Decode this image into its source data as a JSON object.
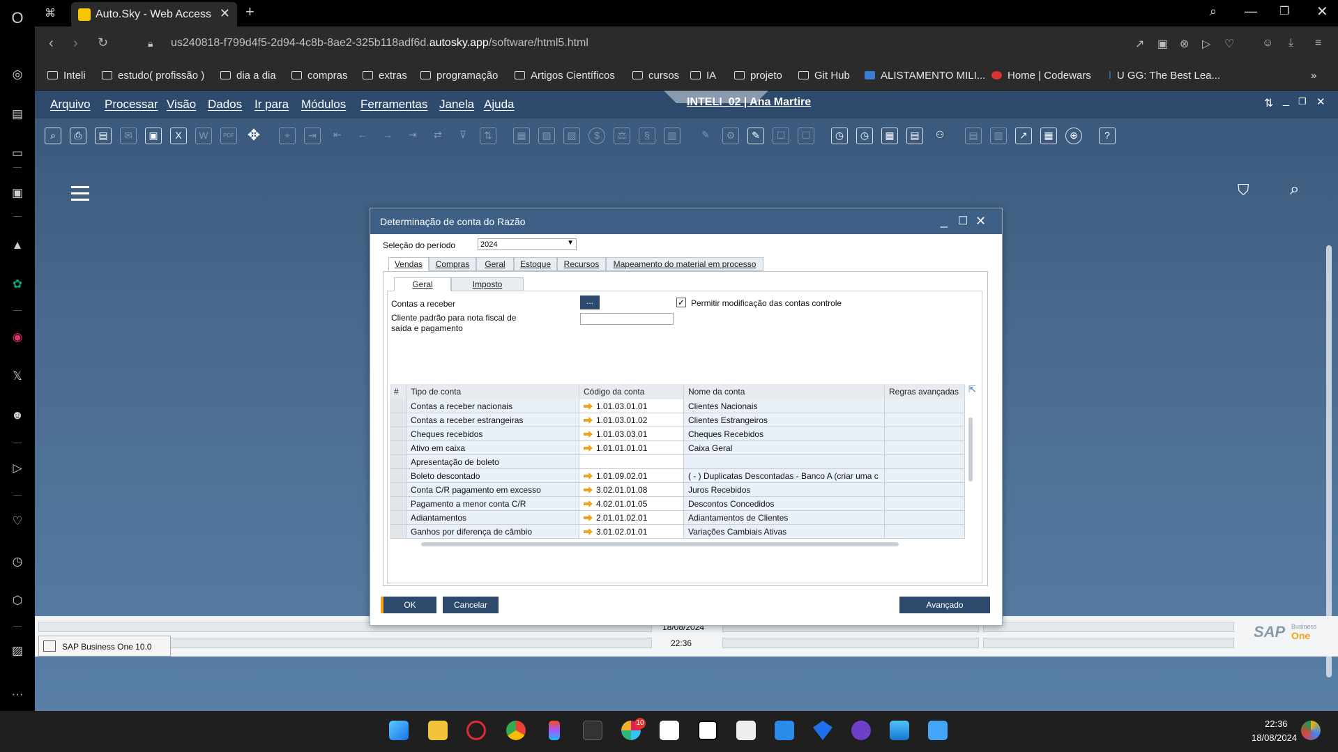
{
  "browser": {
    "tab_title": "Auto.Sky - Web Access",
    "url_prefix": "us240818-f799d4f5-2d94-4c8b-8ae2-325b118adf6d.",
    "url_domain": "autosky.app",
    "url_suffix": "/software/html5.html",
    "bookmarks": [
      "Inteli",
      "estudo( profissão )",
      "dia a dia",
      "compras",
      "extras",
      "programação",
      "Artigos Científicos",
      "cursos",
      "IA",
      "projeto",
      "Git Hub",
      "ALISTAMENTO MILI...",
      "Home | Codewars",
      "GG: The Best Lea..."
    ]
  },
  "sap": {
    "menus": [
      "Arquivo",
      "Processar",
      "Visão",
      "Dados",
      "Ir para",
      "Módulos",
      "Ferramentas",
      "Janela",
      "Ajuda"
    ],
    "db_title": "INTELI_02 | Ana Martire"
  },
  "dialog": {
    "title": "Determinação de conta do Razão",
    "period_label": "Seleção do período",
    "period_value": "2024",
    "tabs": [
      "Vendas",
      "Compras",
      "Geral",
      "Estoque",
      "Recursos",
      "Mapeamento do material em processo"
    ],
    "subtabs": [
      "Geral",
      "Imposto"
    ],
    "contas_receber_label": "Contas a receber",
    "ellipsis_button": "...",
    "cliente_padrao_label": "Cliente padrão para nota fiscal de saída e pagamento",
    "permitir_label": "Permitir modificação das contas controle",
    "permitir_checked": true,
    "table_headers": [
      "#",
      "Tipo de conta",
      "Código da conta",
      "Nome da conta",
      "Regras avançadas"
    ],
    "rows": [
      {
        "tipo": "Contas a receber nacionais",
        "codigo": "1.01.03.01.01",
        "nome": "Clientes Nacionais"
      },
      {
        "tipo": "Contas a receber estrangeiras",
        "codigo": "1.01.03.01.02",
        "nome": "Clientes Estrangeiros"
      },
      {
        "tipo": "Cheques recebidos",
        "codigo": "1.01.03.03.01",
        "nome": "Cheques Recebidos"
      },
      {
        "tipo": "Ativo em caixa",
        "codigo": "1.01.01.01.01",
        "nome": "Caixa Geral"
      },
      {
        "tipo": "Apresentação de boleto",
        "codigo": "",
        "nome": ""
      },
      {
        "tipo": "Boleto descontado",
        "codigo": "1.01.09.02.01",
        "nome": "( - ) Duplicatas Descontadas - Banco A (criar uma c"
      },
      {
        "tipo": "Conta C/R pagamento em excesso",
        "codigo": "3.02.01.01.08",
        "nome": "Juros Recebidos"
      },
      {
        "tipo": "Pagamento a menor conta C/R",
        "codigo": "4.02.01.01.05",
        "nome": "Descontos Concedidos"
      },
      {
        "tipo": "Adiantamentos",
        "codigo": "2.01.01.02.01",
        "nome": "Adiantamentos de Clientes"
      },
      {
        "tipo": "Ganhos por diferença de câmbio",
        "codigo": "3.01.02.01.01",
        "nome": "Variações Cambiais Ativas"
      }
    ],
    "buttons": {
      "ok": "OK",
      "cancel": "Cancelar",
      "advanced": "Avançado"
    }
  },
  "status": {
    "date": "18/08/2024",
    "time": "22:36",
    "sap_window": "SAP Business One 10.0",
    "logo_text": "SAP",
    "logo_sub1": "Business",
    "logo_sub2": "One"
  },
  "taskbar": {
    "clock_time": "22:36",
    "clock_date": "18/08/2024",
    "badge_count": "10"
  }
}
